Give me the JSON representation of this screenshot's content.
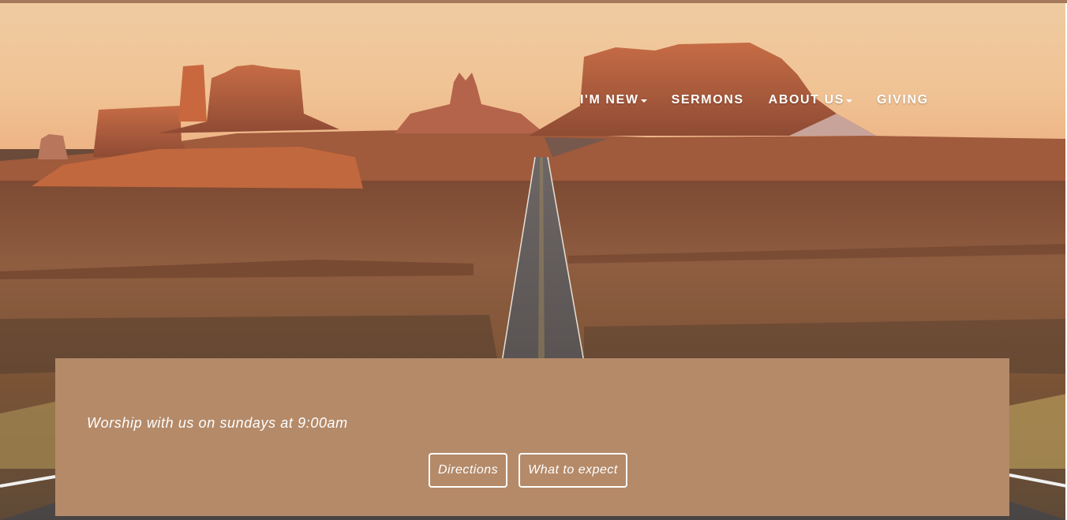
{
  "nav": {
    "items": [
      {
        "label": "I'M NEW",
        "has_dropdown": true
      },
      {
        "label": "SERMONS",
        "has_dropdown": false
      },
      {
        "label": "ABOUT US",
        "has_dropdown": true
      },
      {
        "label": "GIVING",
        "has_dropdown": false
      }
    ]
  },
  "hero": {
    "image_icon": "desert-landscape-image"
  },
  "info": {
    "worship_text": "Worship with us on sundays at 9:00am",
    "buttons": {
      "directions": "Directions",
      "what_to_expect": "What to expect"
    }
  },
  "colors": {
    "panel": "#b48a69",
    "top_strip": "#a5795c",
    "text": "#ffffff"
  }
}
